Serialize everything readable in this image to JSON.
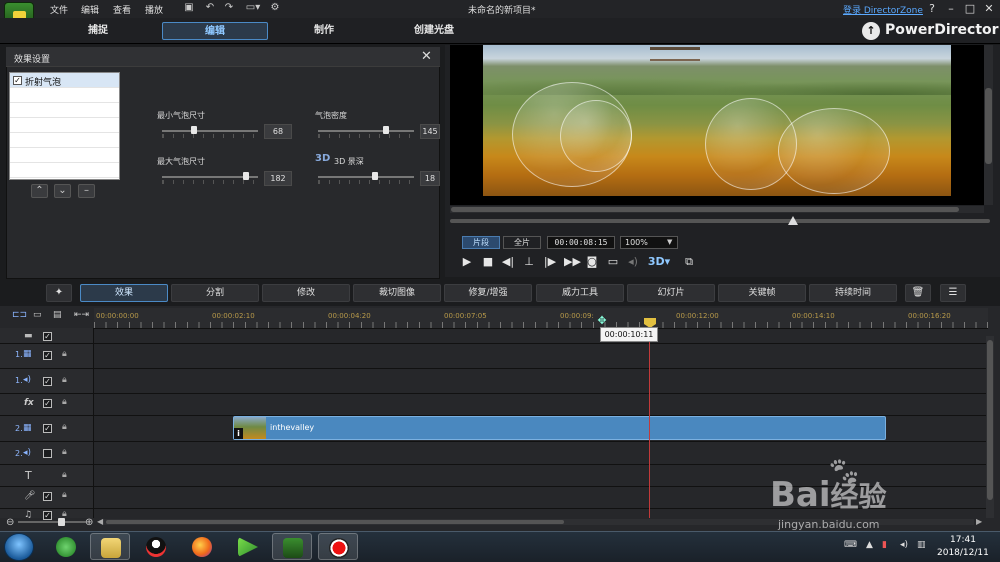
{
  "titlebar": {
    "menus": [
      "文件",
      "编辑",
      "查看",
      "播放"
    ],
    "doc_title": "未命名的新项目*",
    "login": "登录 DirectorZone",
    "help": "?",
    "minimize": "–",
    "maximize": "□",
    "close": "✕"
  },
  "modes": [
    "捕捉",
    "编辑",
    "制作",
    "创建光盘"
  ],
  "active_mode": "编辑",
  "brand": "PowerDirector",
  "fx_panel": {
    "title": "效果设置",
    "close": "✕",
    "effects": [
      {
        "label": "折射气泡",
        "checked": true
      }
    ],
    "params": {
      "min_bubble_label": "最小气泡尺寸",
      "min_bubble_value": "68",
      "bubble_density_label": "气泡密度",
      "bubble_density_value": "145",
      "max_bubble_label": "最大气泡尺寸",
      "max_bubble_value": "182",
      "depth_3d_label": "3D 景深",
      "depth_3d_value": "18"
    }
  },
  "preview": {
    "clip_tab": "片段",
    "full_tab": "全片",
    "timecode": "00:00:08:15",
    "zoom": "100%"
  },
  "func_bar": [
    "效果",
    "分割",
    "修改",
    "裁切图像",
    "修复/增强",
    "威力工具",
    "幻灯片",
    "关键帧",
    "持续时间"
  ],
  "timeline": {
    "ruler_labels": [
      "00:00:00:00",
      "00:00:02:10",
      "00:00:04:20",
      "00:00:07:05",
      "00:00:09:",
      "00:00:12:00",
      "00:00:14:10",
      "00:00:16:20"
    ],
    "tooltip": "00:00:10:11",
    "clip_name": "inthevalley",
    "tracks": [
      {
        "num": "",
        "icon": "▦",
        "checked": true,
        "lock": false
      },
      {
        "num": "1.",
        "icon": "▦",
        "checked": true,
        "lock": true
      },
      {
        "num": "1.",
        "icon": "◂)",
        "checked": true,
        "lock": true
      },
      {
        "num": "",
        "icon": "fx",
        "checked": true,
        "lock": true
      },
      {
        "num": "2.",
        "icon": "▦",
        "checked": true,
        "lock": true
      },
      {
        "num": "2.",
        "icon": "◂)",
        "checked": false,
        "lock": true
      },
      {
        "num": "",
        "icon": "T",
        "checked": null,
        "lock": true
      },
      {
        "num": "",
        "icon": "🎤",
        "checked": true,
        "lock": true
      },
      {
        "num": "",
        "icon": "♫",
        "checked": true,
        "lock": true
      }
    ]
  },
  "taskbar": {
    "time": "17:41",
    "date": "2018/12/11"
  },
  "watermark": {
    "text": "Bai",
    "suffix": "经验",
    "url": "jingyan.baidu.com"
  }
}
